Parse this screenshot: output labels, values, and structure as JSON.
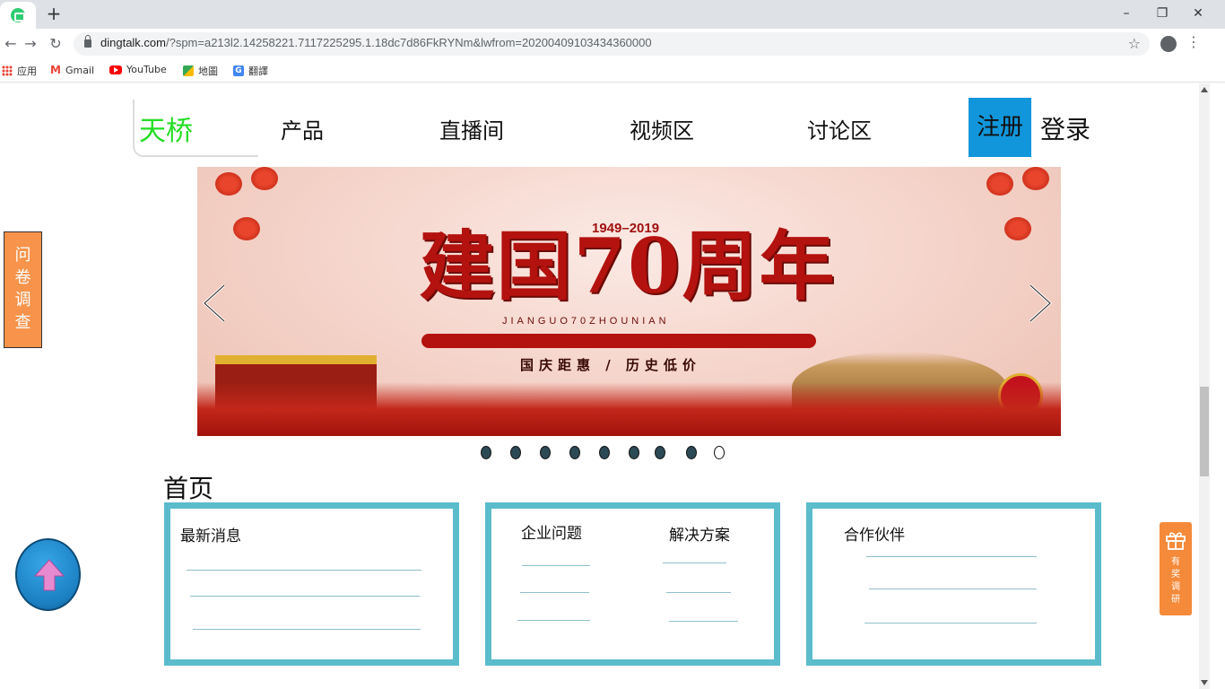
{
  "browser": {
    "new_tab": "+",
    "url_host": "dingtalk.com",
    "url_path": "/?spm=a213l2.14258221.7117225295.1.18dc7d86FkRYNm&lwfrom=20200409103434360000",
    "window_controls": {
      "minimize": "–",
      "maximize": "❐",
      "close": "✕"
    },
    "bookmarks": [
      "应用",
      "Gmail",
      "YouTube",
      "地圖",
      "翻譯"
    ]
  },
  "header": {
    "logo": "天桥",
    "nav": [
      "产品",
      "直播间",
      "视频区",
      "讨论区"
    ],
    "register": "注册",
    "login": "登录",
    "register_color": "#1296db"
  },
  "banner": {
    "year_range": "1949–2019",
    "title": "建国70周年",
    "pinyin": "JIANGUO70ZHOUNIAN",
    "slogan": "国庆距惠 / 历史低价",
    "slide_count": 9,
    "active_slide": 9
  },
  "section": {
    "title": "首页",
    "cards": [
      {
        "titles": [
          "最新消息"
        ]
      },
      {
        "titles": [
          "企业问题",
          "解决方案"
        ]
      },
      {
        "titles": [
          "合作伙伴"
        ]
      }
    ],
    "card_border_color": "#5bbccc"
  },
  "widgets": {
    "survey_chars": [
      "问",
      "卷",
      "调",
      "查"
    ],
    "gift_chars": [
      "有",
      "奖",
      "调",
      "研"
    ],
    "back_to_top_icon": "arrow-up-icon"
  }
}
